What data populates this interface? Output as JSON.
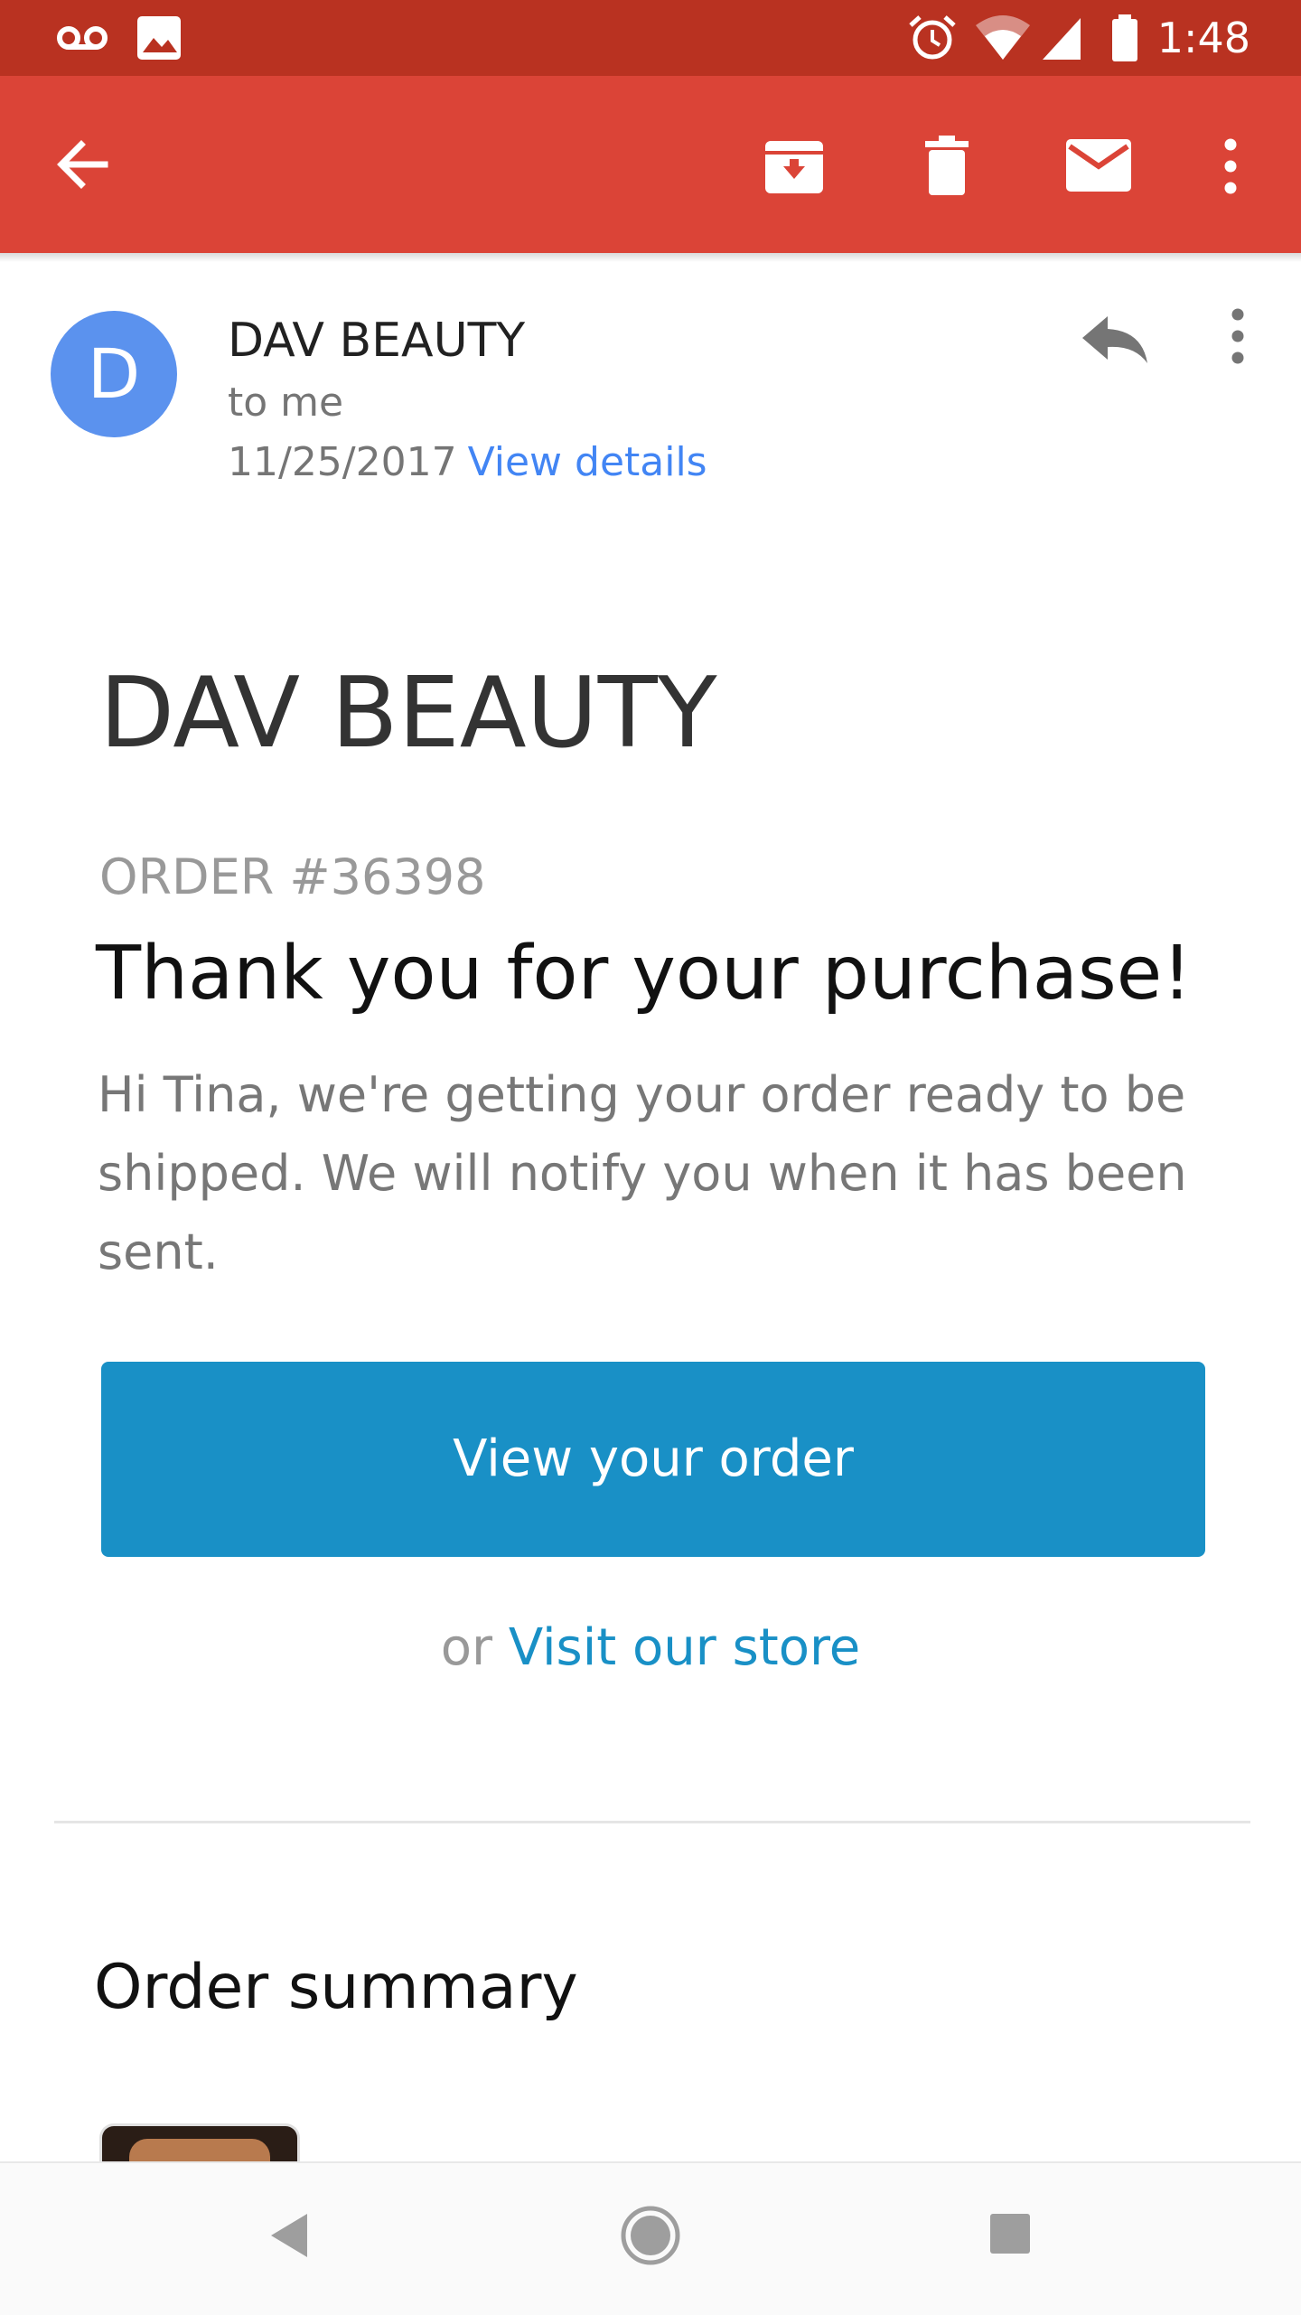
{
  "status_bar": {
    "time": "1:48",
    "left_icons": [
      "voicemail-icon",
      "image-icon"
    ],
    "right_icons": [
      "alarm-icon",
      "wifi-icon",
      "signal-icon",
      "battery-icon"
    ],
    "color": "#b93221"
  },
  "app_bar": {
    "color": "#db4437",
    "actions": [
      "back-arrow-icon",
      "archive-icon",
      "delete-icon",
      "mark-unread-icon",
      "more-vert-icon"
    ]
  },
  "email": {
    "avatar_letter": "D",
    "avatar_color": "#5b92ee",
    "sender": "DAV BEAUTY",
    "recipient": "to me",
    "date": "11/25/2017",
    "view_details": "View details"
  },
  "body": {
    "brand": "DAV BEAUTY",
    "order_number": "ORDER #36398",
    "headline": "Thank you for your purchase!",
    "message": "Hi Tina, we're getting your order ready to be shipped. We will notify you when it has been sent.",
    "cta_label": "View your order",
    "cta_color": "#1990c6",
    "store_prefix": "or",
    "store_link": "Visit our store",
    "summary_title": "Order summary"
  },
  "nav_bar": {
    "buttons": [
      "back-triangle-icon",
      "home-circle-icon",
      "recents-square-icon"
    ]
  }
}
